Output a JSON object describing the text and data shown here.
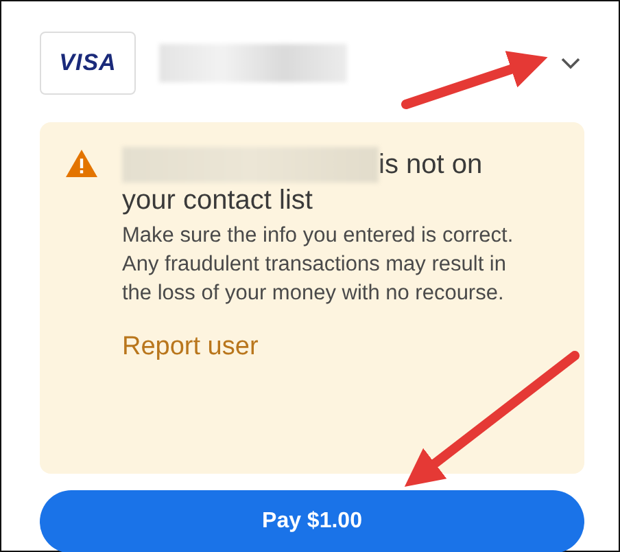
{
  "payment_method": {
    "brand": "VISA"
  },
  "warning": {
    "title": "is not on your contact list",
    "body": "Make sure the info you entered is correct. Any fraudulent transactions may result in the loss of your money with no recourse.",
    "link": "Report user"
  },
  "pay_button": {
    "label": "Pay $1.00"
  }
}
